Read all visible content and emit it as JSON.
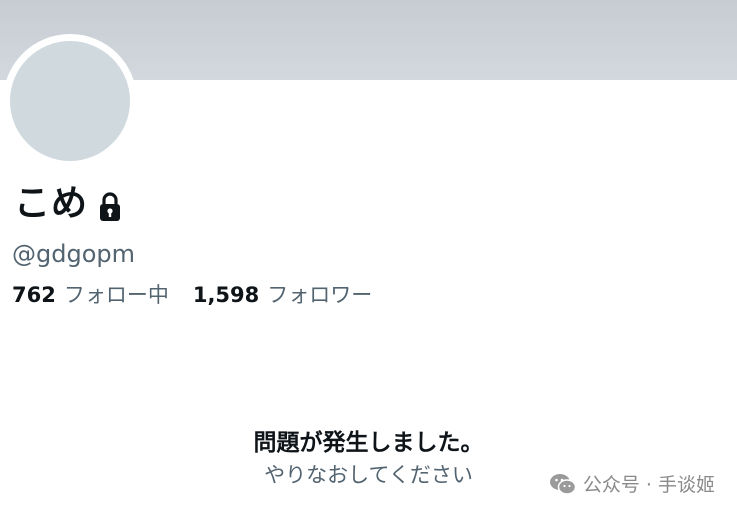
{
  "profile": {
    "display_name": "こめ",
    "handle": "@gdgopm",
    "protected_icon": "lock-icon",
    "following_count": "762",
    "following_label": "フォロー中",
    "followers_count": "1,598",
    "followers_label": "フォロワー"
  },
  "error": {
    "title": "問題が発生しました。",
    "retry_label": "やりなおしてください"
  },
  "watermark": {
    "icon": "wechat-icon",
    "text": "公众号 · 手谈姬"
  },
  "colors": {
    "banner": "#c6ccd2",
    "avatar": "#cfd9de",
    "primary_text": "#0f1419",
    "secondary_text": "#536471"
  }
}
